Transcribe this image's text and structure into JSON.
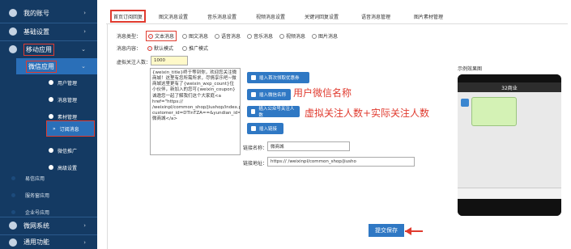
{
  "sidebar": {
    "items": [
      {
        "label": "我的账号"
      },
      {
        "label": "基础设置"
      },
      {
        "label": "移动应用"
      }
    ],
    "active_item": {
      "label": "微信应用"
    },
    "subitems": [
      {
        "label": "用户管理"
      },
      {
        "label": "消息管理"
      },
      {
        "label": "素材管理"
      },
      {
        "label": "订阅消息"
      },
      {
        "label": "微信推广"
      },
      {
        "label": "高级设置"
      }
    ],
    "lower_items": [
      {
        "label": "易信应用"
      },
      {
        "label": "服务窗应用"
      },
      {
        "label": "企业号应用"
      }
    ],
    "bottom_items": [
      {
        "label": "微网系统"
      },
      {
        "label": "通用功能"
      }
    ]
  },
  "tabs": [
    {
      "label": "首页订阅回复"
    },
    {
      "label": "图文消息设置"
    },
    {
      "label": "音乐消息设置"
    },
    {
      "label": "视频消息设置"
    },
    {
      "label": "关键词回复设置"
    },
    {
      "label": "语音消息管理"
    },
    {
      "label": "图片素材管理"
    }
  ],
  "form": {
    "msg_type_label": "消息类型：",
    "msg_types": [
      {
        "label": "文本消息"
      },
      {
        "label": "图文消息"
      },
      {
        "label": "语音消息"
      },
      {
        "label": "音乐消息"
      },
      {
        "label": "视频消息"
      },
      {
        "label": "图片消息"
      }
    ],
    "content_label": "消息内容：",
    "content_modes": [
      {
        "label": "默认模式"
      },
      {
        "label": "推广模式"
      }
    ],
    "virtual_label": "虚拟关注人数：",
    "virtual_value": "1000",
    "textarea": "{weixin_title}终于等到你，欢迎您关注微商城！这里有您所需所求，尽情享乐吧~微商城这里更有了{weixin_wxp_count}位小伙伴，新加入的您可{weixin_coupon}诚邀您一起了解我们这个大家庭<a href=\"https://                 /weixinpl/common_shop/jiushop/index.php?customer_id=DTInTZA==&yundian_id=-1&menu_id=11939&code=081X9A6T0IA6Y1sTD6T09Tw6T0X9A6d&state=wxy\">微商城</a>",
    "btn_insert_fans": "插入首次领取优惠券",
    "btn_insert_name": "插入微信名称",
    "btn_insert_count": "插入公众号关注人数",
    "btn_insert_link": "插入链接",
    "link_name_label": "链接名称：",
    "link_name_value": "微商城",
    "link_url_label": "链接地址：",
    "link_url_value": "https://               /weixinpl/common_shop/jiusho"
  },
  "annotations": {
    "wechat_name": "用户微信名称",
    "follow_count": "虚拟关注人数+实际关注人数"
  },
  "preview": {
    "label": "示例效果图",
    "chat_title": "32商业"
  },
  "submit_label": "提交保存"
}
